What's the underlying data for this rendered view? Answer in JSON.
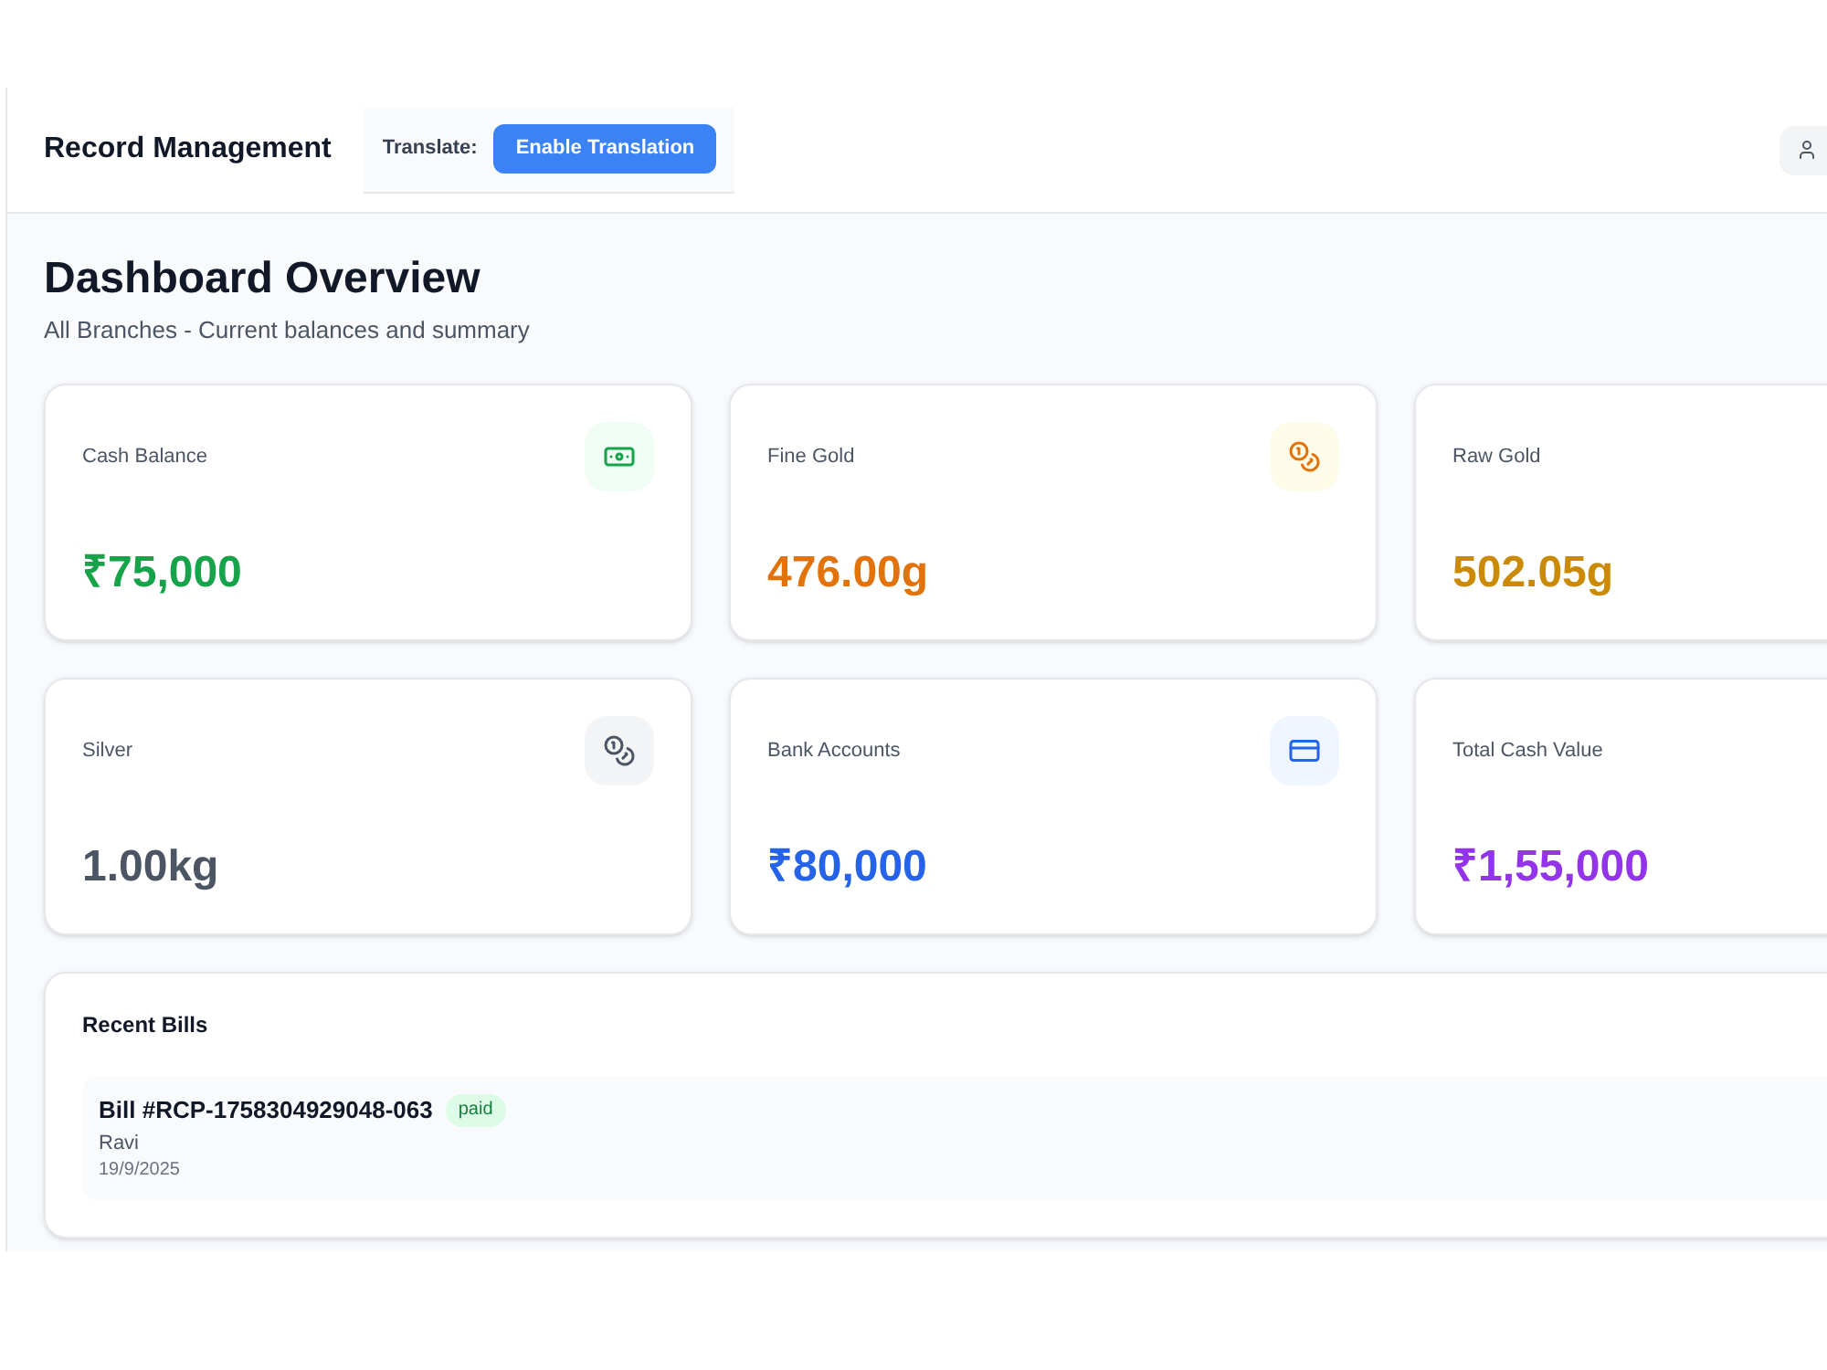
{
  "header": {
    "title": "Record Management",
    "translate": {
      "label": "Translate:",
      "button": "Enable Translation"
    }
  },
  "page": {
    "title": "Dashboard Overview",
    "subtitle": "All Branches - Current balances and summary"
  },
  "cards": [
    {
      "label": "Cash Balance",
      "value": "₹75,000",
      "color": "#16a34a",
      "kind": "cash"
    },
    {
      "label": "Fine Gold",
      "value": "476.00g",
      "color": "#e2720a",
      "kind": "gold"
    },
    {
      "label": "Raw Gold",
      "value": "502.05g",
      "color": "#ca8a04",
      "kind": "plain"
    },
    {
      "label": "Silver",
      "value": "1.00kg",
      "color": "#4b5563",
      "kind": "silver"
    },
    {
      "label": "Bank Accounts",
      "value": "₹80,000",
      "color": "#2563eb",
      "kind": "bank"
    },
    {
      "label": "Total Cash Value",
      "value": "₹1,55,000",
      "color": "#9333ea",
      "kind": "plain"
    }
  ],
  "recent_bills": {
    "title": "Recent Bills",
    "bills": [
      {
        "number": "Bill #RCP-1758304929048-063",
        "status": "paid",
        "customer": "Ravi",
        "date": "19/9/2025"
      }
    ]
  }
}
